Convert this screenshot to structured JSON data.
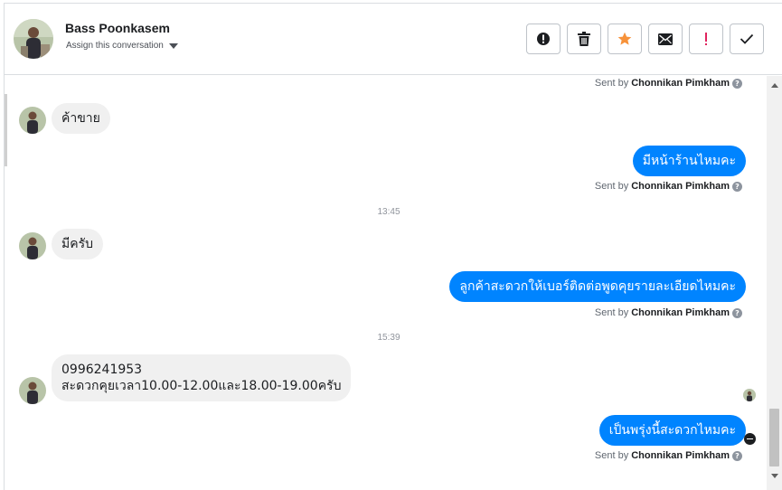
{
  "header": {
    "contact_name": "Bass Poonkasem",
    "assign_label": "Assign this conversation",
    "toolbar": [
      {
        "name": "mark-spam-button",
        "icon": "alert-circle-icon"
      },
      {
        "name": "delete-button",
        "icon": "trash-icon"
      },
      {
        "name": "star-button",
        "icon": "star-icon"
      },
      {
        "name": "mark-unread-button",
        "icon": "envelope-icon"
      },
      {
        "name": "important-button",
        "icon": "exclamation-icon"
      },
      {
        "name": "done-button",
        "icon": "checkmark-icon"
      }
    ]
  },
  "colors": {
    "outgoing_bubble": "#0084ff",
    "incoming_bubble": "#f0f0f0",
    "star": "#f7923a",
    "important": "#e0245e"
  },
  "messages": {
    "sent_by_prefix": "Sent by",
    "agent_name": "Chonnikan Pimkham",
    "help_glyph": "?",
    "m1_in": "ค้าขาย",
    "m2_out": "มีหน้าร้านไหมคะ",
    "time1": "13:45",
    "m3_in": "มีครับ",
    "m4_out": "ลูกค้าสะดวกให้เบอร์ติดต่อพูดคุยรายละเอียดไหมคะ",
    "time2": "15:39",
    "m5_in_line1": "0996241953",
    "m5_in_line2": "สะดวกคุยเวลา10.00-12.00และ18.00-19.00ครับ",
    "m6_out": "เป็นพรุ่งนี้สะดวกไหมคะ"
  }
}
